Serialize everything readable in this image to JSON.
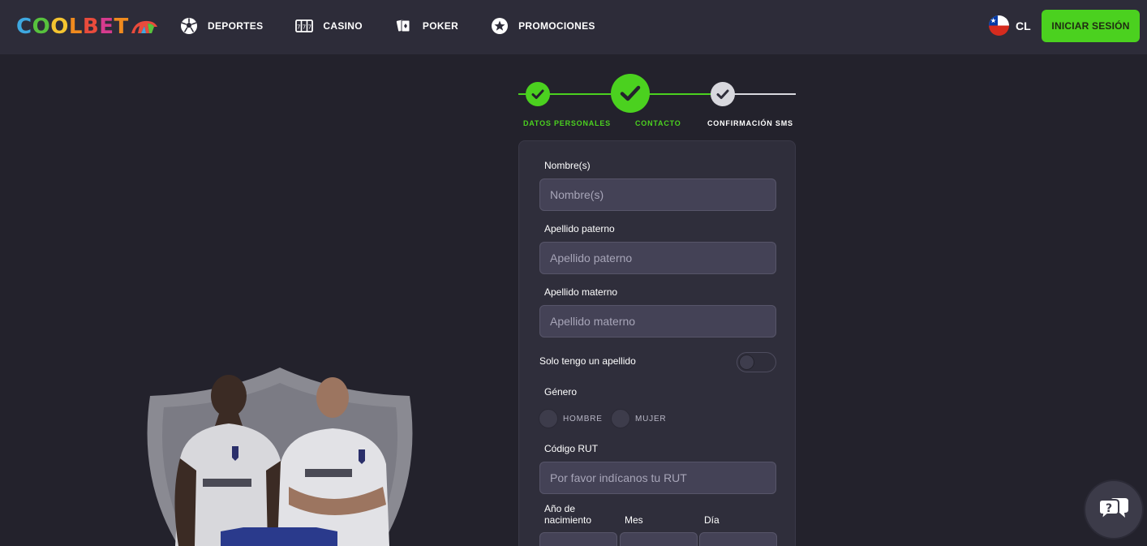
{
  "brand": {
    "logo_text": "COOLBET",
    "logo_letters": [
      "C",
      "O",
      "O",
      "L",
      "B",
      "E",
      "T"
    ],
    "logo_colors": [
      "#3ea8e0",
      "#57c23d",
      "#f4c430",
      "#f08a1e",
      "#e94b3c",
      "#d63b8e",
      "#f08a1e"
    ]
  },
  "nav": {
    "items": [
      {
        "label": "DEPORTES",
        "icon": "soccer-ball-icon"
      },
      {
        "label": "CASINO",
        "icon": "slot-machine-icon"
      },
      {
        "label": "POKER",
        "icon": "playing-cards-icon"
      },
      {
        "label": "PROMOCIONES",
        "icon": "star-badge-icon"
      }
    ]
  },
  "header": {
    "language": "CL",
    "flag_icon": "chile-flag-icon",
    "login_label": "INICIAR SESIÓN"
  },
  "stepper": {
    "steps": [
      {
        "label": "DATOS PERSONALES",
        "state": "done"
      },
      {
        "label": "CONTACTO",
        "state": "current"
      },
      {
        "label": "CONFIRMACIÓN SMS",
        "state": "pending"
      }
    ]
  },
  "form": {
    "first_name": {
      "label": "Nombre(s)",
      "placeholder": "Nombre(s)",
      "value": ""
    },
    "paternal_surname": {
      "label": "Apellido paterno",
      "placeholder": "Apellido paterno",
      "value": ""
    },
    "maternal_surname": {
      "label": "Apellido materno",
      "placeholder": "Apellido materno",
      "value": ""
    },
    "single_surname_toggle": {
      "label": "Solo tengo un apellido",
      "on": false
    },
    "gender": {
      "label": "Género",
      "options": [
        "HOMBRE",
        "MUJER"
      ],
      "selected": null
    },
    "rut": {
      "label": "Código RUT",
      "placeholder": "Por favor indícanos tu RUT",
      "value": ""
    },
    "birth": {
      "year_label": "Año de nacimiento",
      "year_label_lines": [
        "Año de",
        "nacimiento"
      ],
      "month_label": "Mes",
      "day_label": "Día"
    }
  },
  "colors": {
    "accent": "#4bd11f",
    "header_bg": "#2d2c39",
    "page_bg": "#23222c",
    "card_bg": "#2f2e3b",
    "input_bg": "#444256"
  },
  "chat": {
    "icon": "chat-bubbles-icon"
  }
}
